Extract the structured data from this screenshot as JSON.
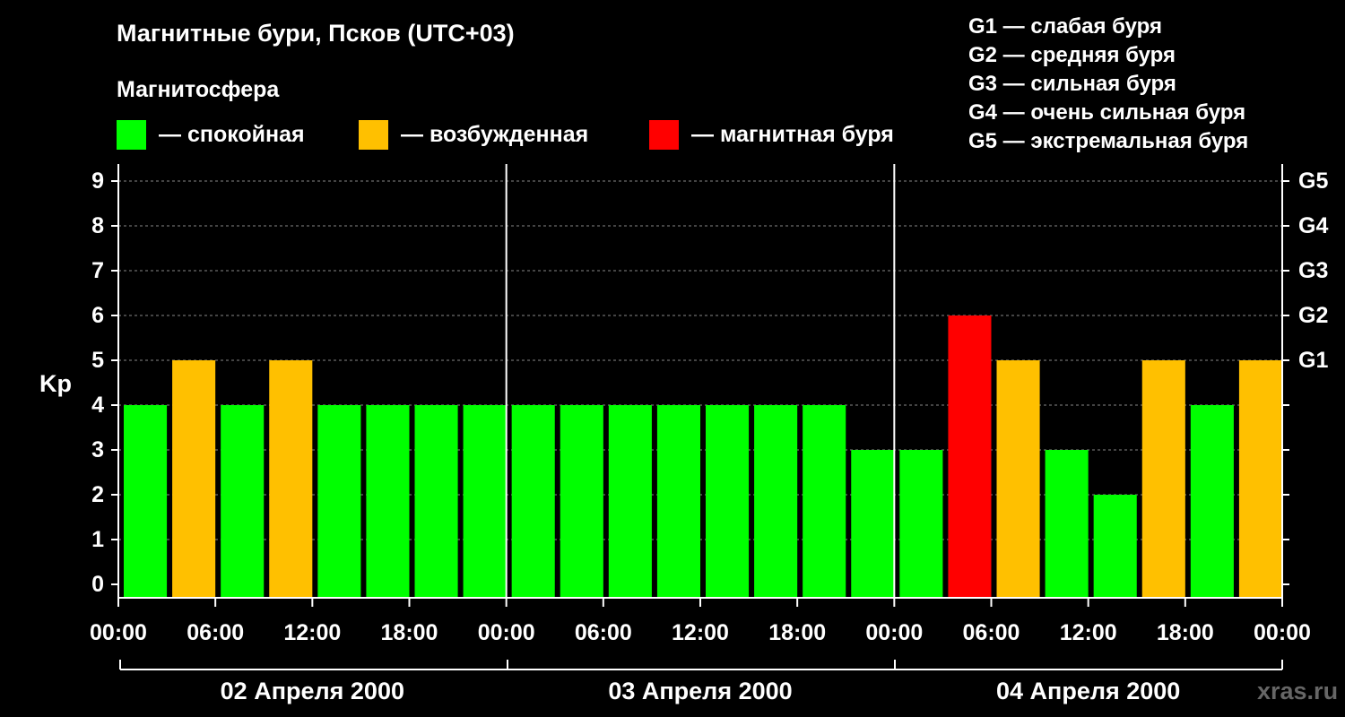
{
  "header": {
    "title": "Магнитные бури, Псков (UTC+03)",
    "subtitle": "Магнитосфера"
  },
  "legend": [
    {
      "label": "— спокойная",
      "color": "#00ff00"
    },
    {
      "label": "— возбужденная",
      "color": "#ffc000"
    },
    {
      "label": "— магнитная буря",
      "color": "#ff0000"
    }
  ],
  "g_legend": [
    "G1 — слабая буря",
    "G2 — средняя буря",
    "G3 — сильная буря",
    "G4 — очень сильная буря",
    "G5 — экстремальная буря"
  ],
  "watermark": "xras.ru",
  "chart_data": {
    "type": "bar",
    "ylabel": "Kp",
    "ylim": [
      0,
      9
    ],
    "y_ticks": [
      0,
      1,
      2,
      3,
      4,
      5,
      6,
      7,
      8,
      9
    ],
    "right_axis_labels": [
      {
        "value": 5,
        "label": "G1"
      },
      {
        "value": 6,
        "label": "G2"
      },
      {
        "value": 7,
        "label": "G3"
      },
      {
        "value": 8,
        "label": "G4"
      },
      {
        "value": 9,
        "label": "G5"
      }
    ],
    "x_tick_labels": [
      "00:00",
      "06:00",
      "12:00",
      "18:00",
      "00:00",
      "06:00",
      "12:00",
      "18:00",
      "00:00",
      "06:00",
      "12:00",
      "18:00",
      "00:00"
    ],
    "days": [
      "02 Апреля 2000",
      "03 Апреля 2000",
      "04 Апреля 2000"
    ],
    "bar_interval_hours": 3,
    "values": [
      3,
      4,
      3,
      4,
      3,
      3,
      3,
      3,
      3,
      3,
      3,
      3,
      3,
      3,
      3,
      2,
      2,
      5,
      4,
      2,
      1,
      4,
      3,
      4
    ],
    "colors": {
      "quiet": "#00ff00",
      "active": "#ffc000",
      "storm": "#ff0000"
    },
    "grid": true
  }
}
